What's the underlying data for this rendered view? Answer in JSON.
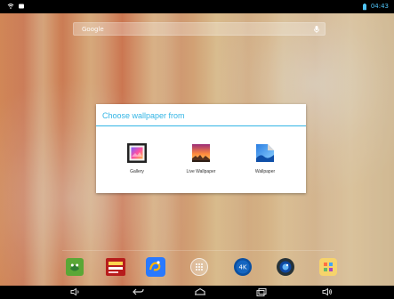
{
  "status_bar": {
    "time": "04:43"
  },
  "search": {
    "label": "Google"
  },
  "dialog": {
    "title": "Choose wallpaper from",
    "options": [
      {
        "label": "Gallery",
        "icon": "gallery-icon"
      },
      {
        "label": "Live Wallpaper",
        "icon": "live-wallpaper-icon"
      },
      {
        "label": "Wallpaper",
        "icon": "wallpaper-icon"
      }
    ]
  },
  "dock": [
    {
      "icon": "frog-app-icon"
    },
    {
      "icon": "cctv-app-icon"
    },
    {
      "icon": "uc-browser-icon"
    },
    {
      "icon": "app-drawer-icon"
    },
    {
      "icon": "4k-app-icon"
    },
    {
      "icon": "camera-icon"
    },
    {
      "icon": "kids-app-icon"
    }
  ],
  "colors": {
    "accent": "#33b5e5",
    "status_time": "#4fc3f7",
    "bars": "#000000"
  }
}
